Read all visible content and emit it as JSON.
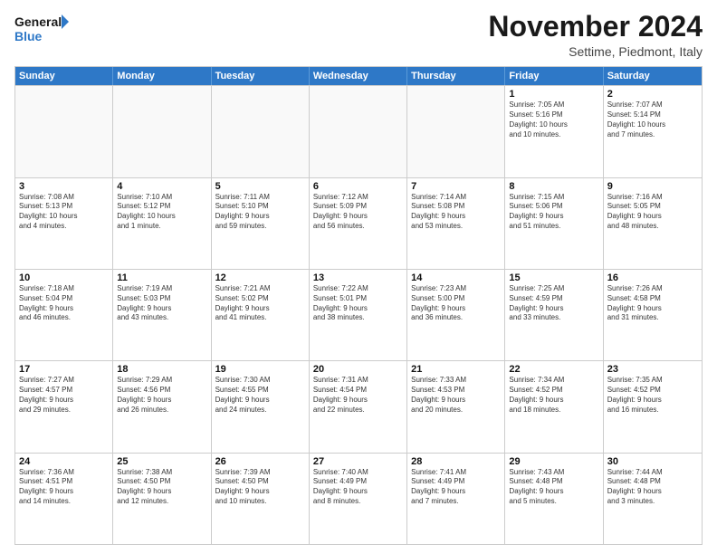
{
  "logo": {
    "line1": "General",
    "line2": "Blue"
  },
  "header": {
    "month": "November 2024",
    "location": "Settime, Piedmont, Italy"
  },
  "weekdays": [
    "Sunday",
    "Monday",
    "Tuesday",
    "Wednesday",
    "Thursday",
    "Friday",
    "Saturday"
  ],
  "weeks": [
    [
      {
        "day": "",
        "info": ""
      },
      {
        "day": "",
        "info": ""
      },
      {
        "day": "",
        "info": ""
      },
      {
        "day": "",
        "info": ""
      },
      {
        "day": "",
        "info": ""
      },
      {
        "day": "1",
        "info": "Sunrise: 7:05 AM\nSunset: 5:16 PM\nDaylight: 10 hours\nand 10 minutes."
      },
      {
        "day": "2",
        "info": "Sunrise: 7:07 AM\nSunset: 5:14 PM\nDaylight: 10 hours\nand 7 minutes."
      }
    ],
    [
      {
        "day": "3",
        "info": "Sunrise: 7:08 AM\nSunset: 5:13 PM\nDaylight: 10 hours\nand 4 minutes."
      },
      {
        "day": "4",
        "info": "Sunrise: 7:10 AM\nSunset: 5:12 PM\nDaylight: 10 hours\nand 1 minute."
      },
      {
        "day": "5",
        "info": "Sunrise: 7:11 AM\nSunset: 5:10 PM\nDaylight: 9 hours\nand 59 minutes."
      },
      {
        "day": "6",
        "info": "Sunrise: 7:12 AM\nSunset: 5:09 PM\nDaylight: 9 hours\nand 56 minutes."
      },
      {
        "day": "7",
        "info": "Sunrise: 7:14 AM\nSunset: 5:08 PM\nDaylight: 9 hours\nand 53 minutes."
      },
      {
        "day": "8",
        "info": "Sunrise: 7:15 AM\nSunset: 5:06 PM\nDaylight: 9 hours\nand 51 minutes."
      },
      {
        "day": "9",
        "info": "Sunrise: 7:16 AM\nSunset: 5:05 PM\nDaylight: 9 hours\nand 48 minutes."
      }
    ],
    [
      {
        "day": "10",
        "info": "Sunrise: 7:18 AM\nSunset: 5:04 PM\nDaylight: 9 hours\nand 46 minutes."
      },
      {
        "day": "11",
        "info": "Sunrise: 7:19 AM\nSunset: 5:03 PM\nDaylight: 9 hours\nand 43 minutes."
      },
      {
        "day": "12",
        "info": "Sunrise: 7:21 AM\nSunset: 5:02 PM\nDaylight: 9 hours\nand 41 minutes."
      },
      {
        "day": "13",
        "info": "Sunrise: 7:22 AM\nSunset: 5:01 PM\nDaylight: 9 hours\nand 38 minutes."
      },
      {
        "day": "14",
        "info": "Sunrise: 7:23 AM\nSunset: 5:00 PM\nDaylight: 9 hours\nand 36 minutes."
      },
      {
        "day": "15",
        "info": "Sunrise: 7:25 AM\nSunset: 4:59 PM\nDaylight: 9 hours\nand 33 minutes."
      },
      {
        "day": "16",
        "info": "Sunrise: 7:26 AM\nSunset: 4:58 PM\nDaylight: 9 hours\nand 31 minutes."
      }
    ],
    [
      {
        "day": "17",
        "info": "Sunrise: 7:27 AM\nSunset: 4:57 PM\nDaylight: 9 hours\nand 29 minutes."
      },
      {
        "day": "18",
        "info": "Sunrise: 7:29 AM\nSunset: 4:56 PM\nDaylight: 9 hours\nand 26 minutes."
      },
      {
        "day": "19",
        "info": "Sunrise: 7:30 AM\nSunset: 4:55 PM\nDaylight: 9 hours\nand 24 minutes."
      },
      {
        "day": "20",
        "info": "Sunrise: 7:31 AM\nSunset: 4:54 PM\nDaylight: 9 hours\nand 22 minutes."
      },
      {
        "day": "21",
        "info": "Sunrise: 7:33 AM\nSunset: 4:53 PM\nDaylight: 9 hours\nand 20 minutes."
      },
      {
        "day": "22",
        "info": "Sunrise: 7:34 AM\nSunset: 4:52 PM\nDaylight: 9 hours\nand 18 minutes."
      },
      {
        "day": "23",
        "info": "Sunrise: 7:35 AM\nSunset: 4:52 PM\nDaylight: 9 hours\nand 16 minutes."
      }
    ],
    [
      {
        "day": "24",
        "info": "Sunrise: 7:36 AM\nSunset: 4:51 PM\nDaylight: 9 hours\nand 14 minutes."
      },
      {
        "day": "25",
        "info": "Sunrise: 7:38 AM\nSunset: 4:50 PM\nDaylight: 9 hours\nand 12 minutes."
      },
      {
        "day": "26",
        "info": "Sunrise: 7:39 AM\nSunset: 4:50 PM\nDaylight: 9 hours\nand 10 minutes."
      },
      {
        "day": "27",
        "info": "Sunrise: 7:40 AM\nSunset: 4:49 PM\nDaylight: 9 hours\nand 8 minutes."
      },
      {
        "day": "28",
        "info": "Sunrise: 7:41 AM\nSunset: 4:49 PM\nDaylight: 9 hours\nand 7 minutes."
      },
      {
        "day": "29",
        "info": "Sunrise: 7:43 AM\nSunset: 4:48 PM\nDaylight: 9 hours\nand 5 minutes."
      },
      {
        "day": "30",
        "info": "Sunrise: 7:44 AM\nSunset: 4:48 PM\nDaylight: 9 hours\nand 3 minutes."
      }
    ]
  ]
}
